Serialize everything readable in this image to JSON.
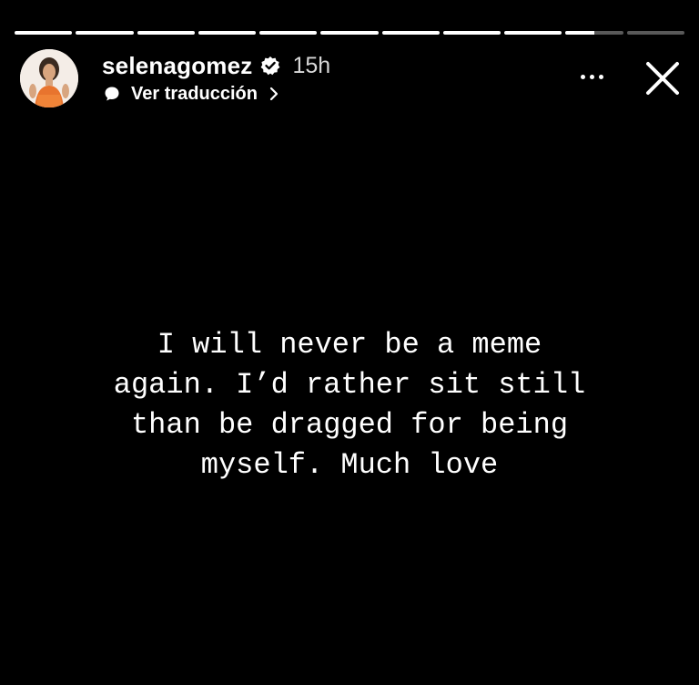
{
  "story": {
    "progress_segments": [
      1,
      1,
      1,
      1,
      1,
      1,
      1,
      1,
      1,
      0.5,
      0
    ],
    "user": {
      "username": "selenagomez",
      "verified_icon": "verified-badge-icon",
      "timestamp": "15h"
    },
    "translate": {
      "icon": "translate-icon",
      "label": "Ver traducción"
    },
    "controls": {
      "more_icon": "more-horizontal-icon",
      "close_icon": "close-icon"
    },
    "text_lines": [
      "I will never be a meme",
      "again. I’d rather sit still",
      "than be dragged for being",
      "myself. Much love"
    ]
  }
}
